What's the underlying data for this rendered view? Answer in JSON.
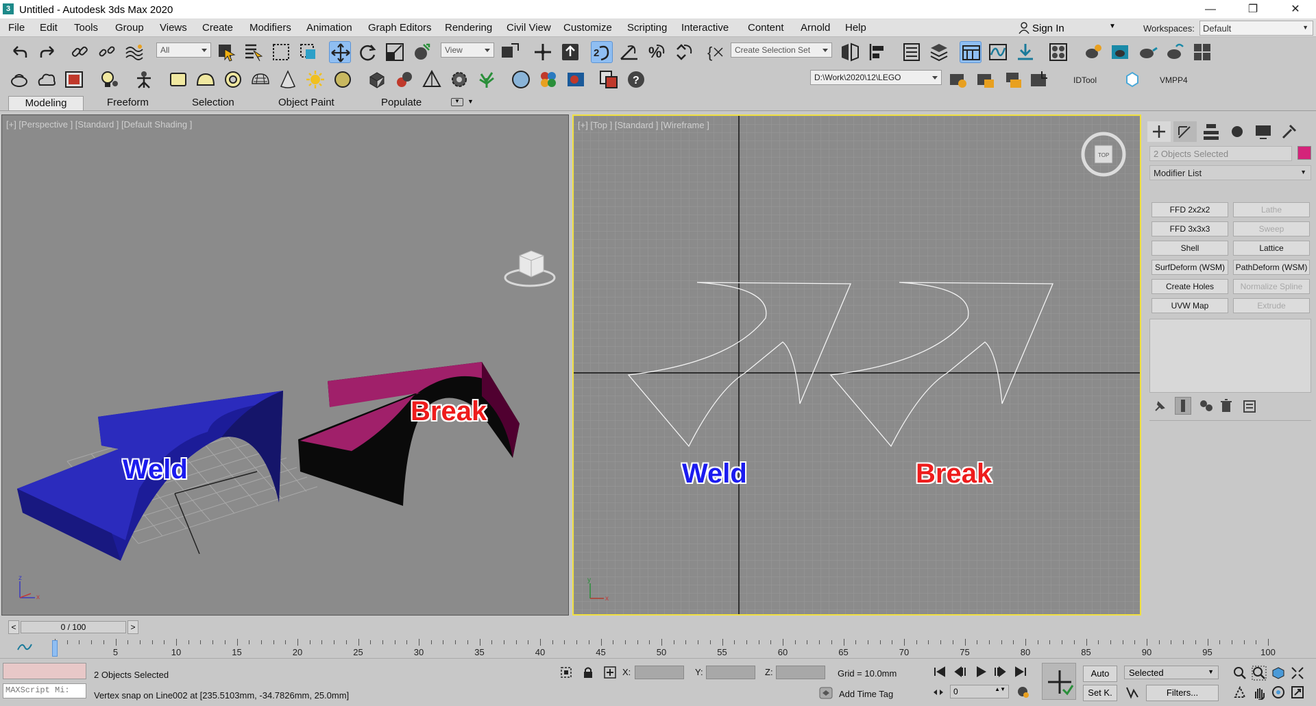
{
  "window": {
    "title": "Untitled - Autodesk 3ds Max 2020",
    "minimize": "—",
    "maximize": "❐",
    "close": "✕"
  },
  "menu": [
    "File",
    "Edit",
    "Tools",
    "Group",
    "Views",
    "Create",
    "Modifiers",
    "Animation",
    "Graph Editors",
    "Rendering",
    "Civil View",
    "Customize",
    "Scripting",
    "Interactive",
    "Content",
    "Arnold",
    "Help"
  ],
  "account": {
    "sign_in": "Sign In",
    "workspaces_label": "Workspaces:",
    "workspace": "Default"
  },
  "toolbar": {
    "filter": "All",
    "ref_coord": "View",
    "selection_set": "Create Selection Set",
    "project_path": "D:\\Work\\2020\\12\\LEGO",
    "axis_x": "X",
    "axis_y": "Y",
    "axis_z": "Z",
    "axis_xy": "XY",
    "axis_xy2": "XY",
    "idtool": "IDTool",
    "vmpp4": "VMPP4"
  },
  "ribbon": {
    "tabs": [
      "Modeling",
      "Freeform",
      "Selection",
      "Object Paint",
      "Populate"
    ],
    "active": "Modeling"
  },
  "viewports": {
    "left": {
      "label": "[+] [Perspective ] [Standard ] [Default Shading ]",
      "text1": "Weld",
      "text2": "Break"
    },
    "right": {
      "label": "[+] [Top ] [Standard ] [Wireframe ]",
      "text1": "Weld",
      "text2": "Break"
    }
  },
  "command_panel": {
    "selection": "2 Objects Selected",
    "object_color": "#d4237a",
    "modifier_list": "Modifier List",
    "modifiers": [
      {
        "label": "FFD 2x2x2",
        "enabled": true
      },
      {
        "label": "Lathe",
        "enabled": false
      },
      {
        "label": "FFD 3x3x3",
        "enabled": true
      },
      {
        "label": "Sweep",
        "enabled": false
      },
      {
        "label": "Shell",
        "enabled": true
      },
      {
        "label": "Lattice",
        "enabled": true
      },
      {
        "label": "SurfDeform (WSM)",
        "enabled": true
      },
      {
        "label": "PathDeform (WSM)",
        "enabled": true
      },
      {
        "label": "Create Holes",
        "enabled": true
      },
      {
        "label": "Normalize Spline",
        "enabled": false
      },
      {
        "label": "UVW Map",
        "enabled": true
      },
      {
        "label": "Extrude",
        "enabled": false
      }
    ]
  },
  "timeline": {
    "frame": "0 / 100",
    "prev": "<",
    "next": ">",
    "ticks": [
      "0",
      "5",
      "10",
      "15",
      "20",
      "25",
      "30",
      "35",
      "40",
      "45",
      "50",
      "55",
      "60",
      "65",
      "70",
      "75",
      "80",
      "85",
      "90",
      "95",
      "100"
    ]
  },
  "status": {
    "maxscript": "MAXScript Mi:",
    "objects": "2 Objects Selected",
    "prompt": "Vertex snap on Line002 at [235.5103mm, -34.7826mm, 25.0mm]",
    "x_label": "X:",
    "y_label": "Y:",
    "z_label": "Z:",
    "grid": "Grid = 10.0mm",
    "add_time_tag": "Add Time Tag",
    "auto": "Auto",
    "selected": "Selected",
    "set_key": "Set K.",
    "filters": "Filters...",
    "frame_value": "0"
  }
}
